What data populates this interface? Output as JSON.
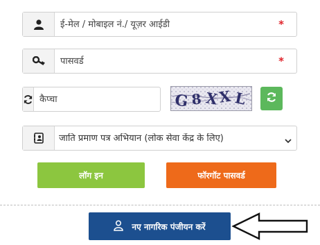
{
  "form": {
    "username": {
      "placeholder": "ई-मेल / मोबाइल नं./ यूज़र आईडी",
      "value": "",
      "required_mark": "*",
      "icon": "user-icon"
    },
    "password": {
      "placeholder": "पासवर्ड",
      "value": "",
      "required_mark": "*",
      "icon": "key-icon"
    },
    "captcha": {
      "placeholder": "कैप्चा",
      "value": "",
      "icon": "refresh-icon",
      "captcha_text": "G8XXL"
    },
    "service_select": {
      "selected": "जाति प्रमाण पत्र अभियान (लोक सेवा केंद्र के लिए)",
      "icon": "id-card-icon"
    }
  },
  "buttons": {
    "login": "लॉग इन",
    "forgot_password": "फॉरगॉट पासवर्ड",
    "register": "नए नागरिक पंजीयन करें"
  },
  "colors": {
    "login": "#8cc63f",
    "forgot": "#ee6a1a",
    "register": "#1c4f8f",
    "refresh": "#5cb85c",
    "required": "#e0242b"
  }
}
